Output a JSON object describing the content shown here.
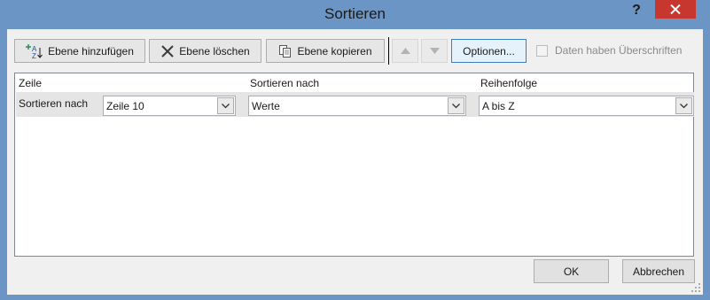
{
  "window": {
    "title": "Sortieren",
    "help": "?"
  },
  "toolbar": {
    "add_level": "Ebene hinzufügen",
    "delete_level": "Ebene löschen",
    "copy_level": "Ebene kopieren",
    "options": "Optionen...",
    "headers_checkbox": "Daten haben Überschriften",
    "headers_checked": false
  },
  "grid": {
    "columns": [
      "Zeile",
      "Sortieren nach",
      "Reihenfolge"
    ],
    "rows": [
      {
        "label": "Sortieren nach",
        "field": "Zeile 10",
        "sort_on": "Werte",
        "order": "A bis Z"
      }
    ]
  },
  "footer": {
    "ok": "OK",
    "cancel": "Abbrechen"
  },
  "colors": {
    "title_bar": "#6a95c4",
    "close": "#c7372f",
    "client": "#f0f0f0",
    "selected_row": "#e5e5e5"
  }
}
